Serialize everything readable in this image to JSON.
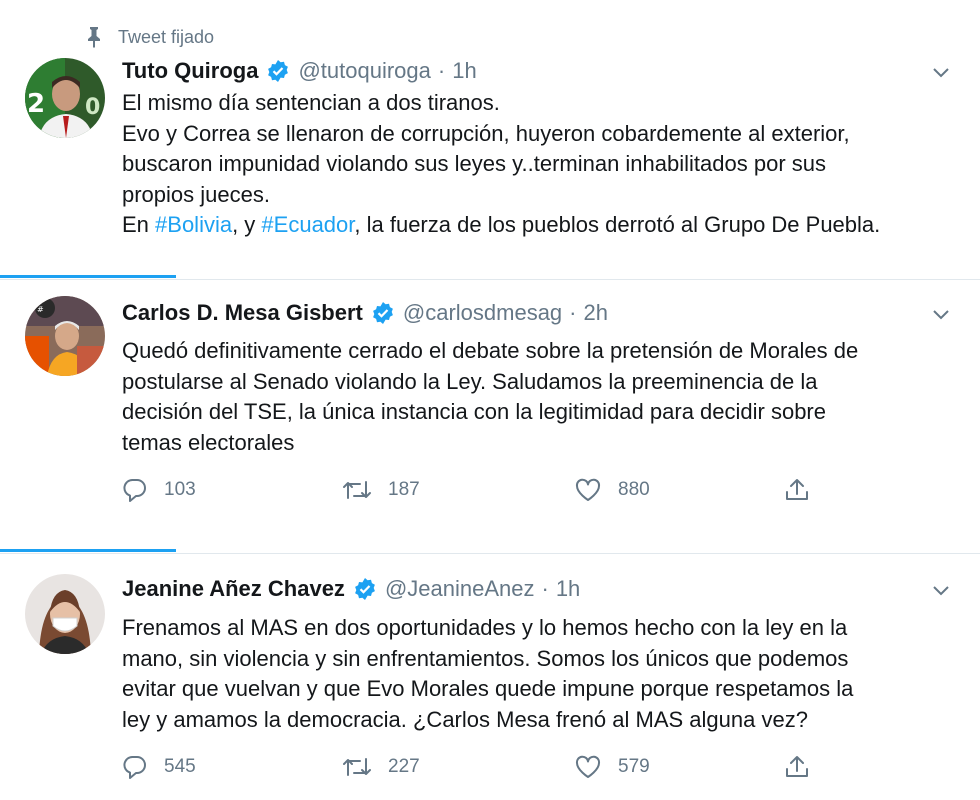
{
  "pinned_label": "Tweet fijado",
  "tweets": [
    {
      "name": "Tuto Quiroga",
      "handle": "@tutoquiroga",
      "separator": "·",
      "time": "1h",
      "lines": [
        "El mismo día sentencian a dos tiranos.",
        "Evo y Correa se llenaron de corrupción, huyeron cobardemente al exterior,",
        "buscaron impunidad violando sus leyes y..terminan inhabilitados por sus",
        "propios jueces."
      ],
      "last_line": {
        "prefix": "En ",
        "hashtag1": "#Bolivia",
        "middle": ", y ",
        "hashtag2": "#Ecuador",
        "suffix": ", la fuerza de los pueblos derrotó al Grupo De Puebla."
      }
    },
    {
      "name": "Carlos D. Mesa Gisbert",
      "handle": "@carlosdmesag",
      "separator": "·",
      "time": "2h",
      "lines": [
        "Quedó definitivamente cerrado el debate sobre la pretensión de Morales de",
        "postularse al Senado violando la Ley. Saludamos la preeminencia de la",
        "decisión del TSE, la única instancia con la legitimidad para decidir sobre",
        "temas electorales"
      ],
      "replies": "103",
      "retweets": "187",
      "likes": "880"
    },
    {
      "name": "Jeanine Añez Chavez",
      "handle": "@JeanineAnez",
      "separator": "·",
      "time": "1h",
      "lines": [
        "Frenamos al MAS en dos oportunidades y lo hemos hecho con la ley en la",
        "mano, sin violencia y sin enfrentamientos. Somos los únicos que podemos",
        "evitar que vuelvan y que Evo Morales quede impune porque respetamos la",
        "ley y amamos la democracia. ¿Carlos Mesa frenó al MAS alguna vez?"
      ],
      "replies": "545",
      "retweets": "227",
      "likes": "579"
    }
  ],
  "colors": {
    "link": "#1da1f2",
    "muted": "#657786",
    "text": "#14171a",
    "divider": "#e1e8ed"
  },
  "icons": [
    "pin-icon",
    "verified-badge-icon",
    "chevron-down-icon",
    "reply-icon",
    "retweet-icon",
    "like-icon",
    "share-icon"
  ]
}
